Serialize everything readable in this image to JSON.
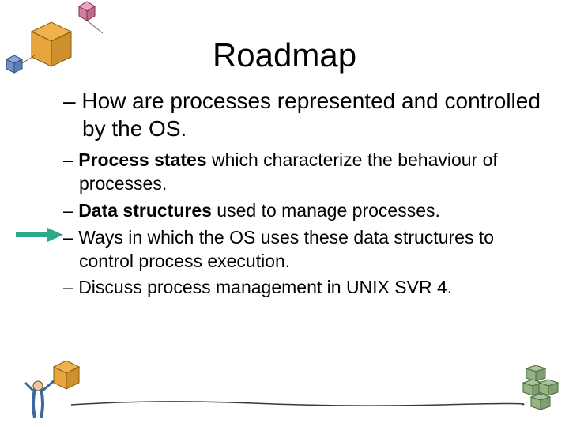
{
  "title": "Roadmap",
  "bullets": {
    "b0": {
      "dash": "– ",
      "text": "How are processes represented and controlled by the OS."
    },
    "b1": {
      "dash": "– ",
      "bold": "Process states",
      "rest": " which characterize the behaviour of processes."
    },
    "b2": {
      "dash": "– ",
      "bold": "Data structures",
      "rest": " used to manage processes."
    },
    "b3": {
      "dash": "– ",
      "text": "Ways in which the OS uses these data structures to control process execution."
    },
    "b4": {
      "dash": "– ",
      "text": "Discuss process management in UNIX SVR 4."
    }
  }
}
